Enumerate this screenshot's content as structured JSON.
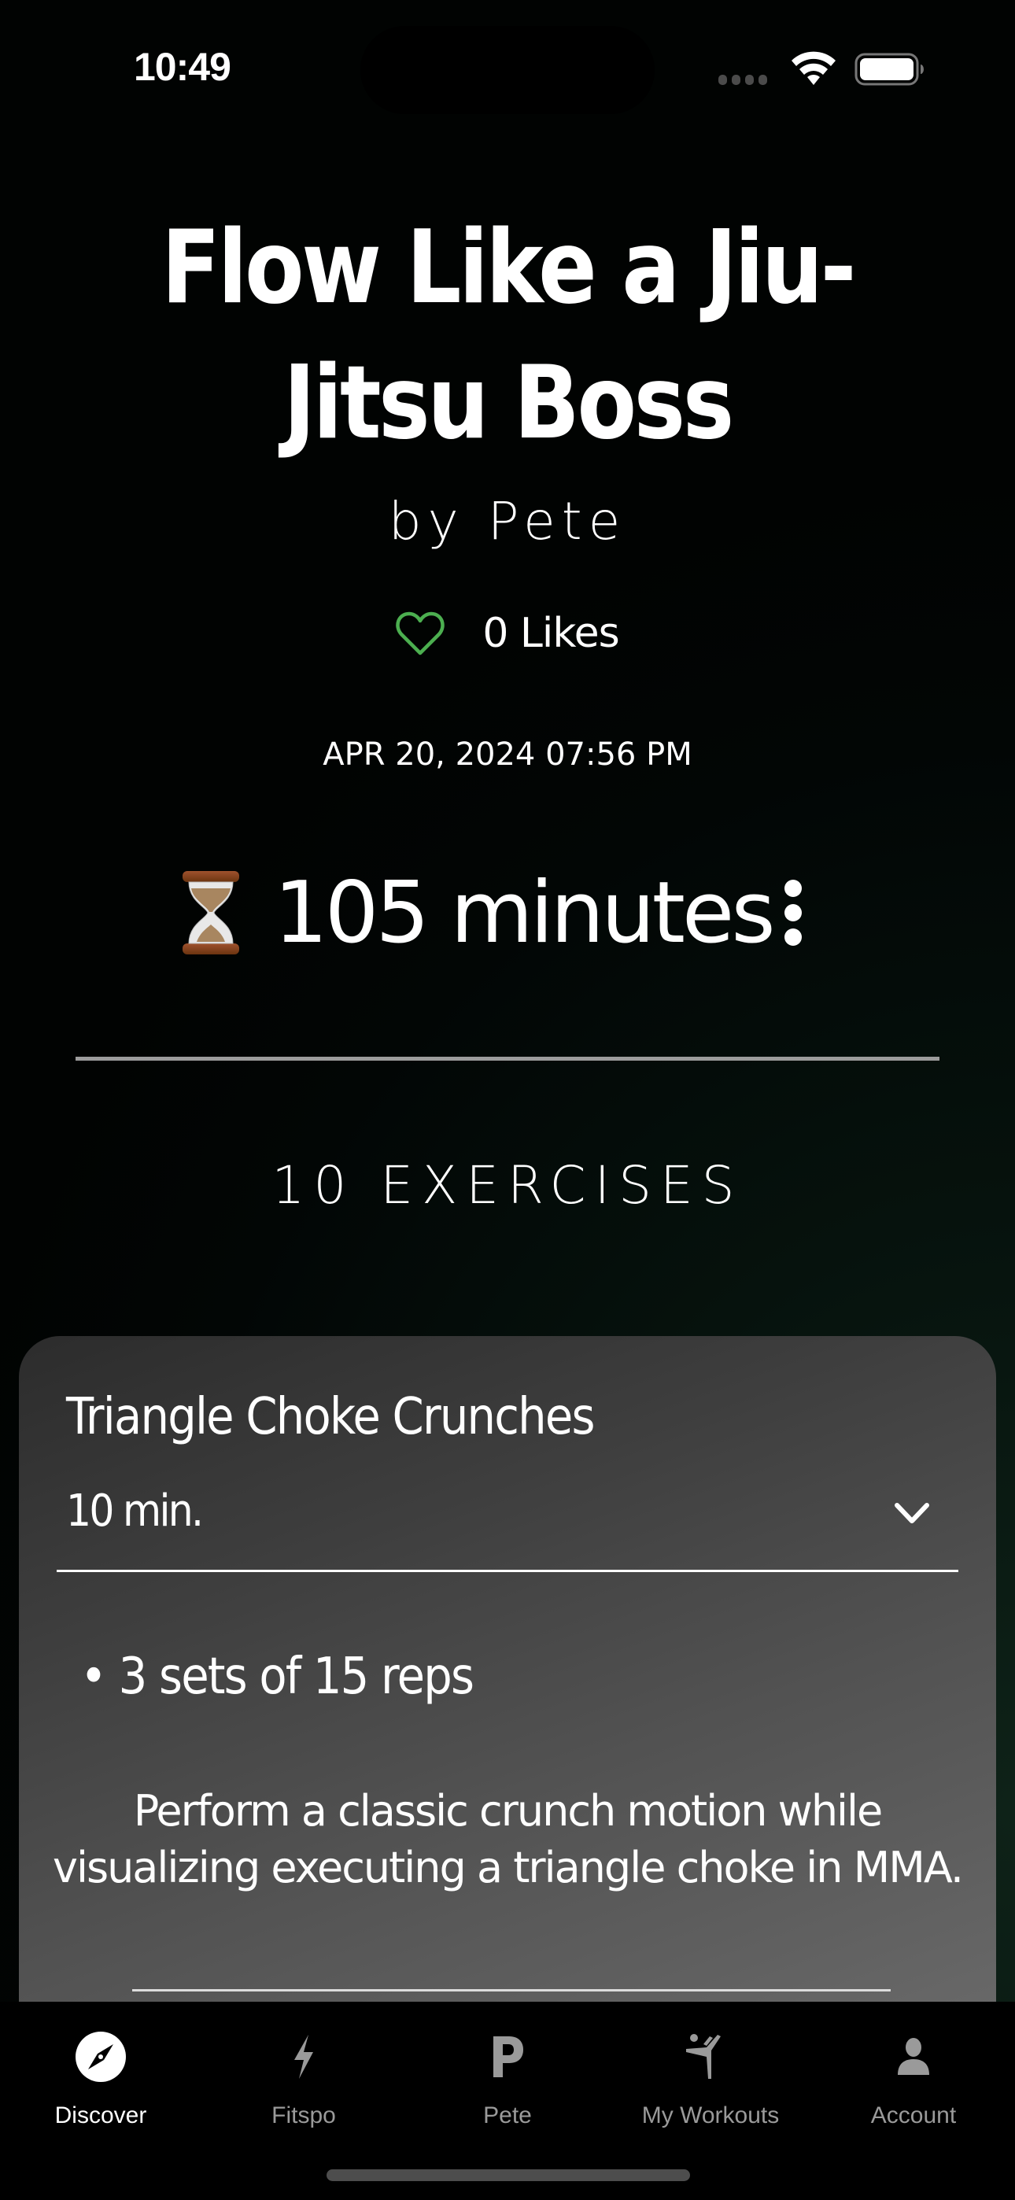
{
  "status_bar": {
    "time": "10:49",
    "icons": [
      "signal-icon",
      "wifi-icon",
      "battery-icon"
    ]
  },
  "workout": {
    "title": "Flow Like a Jiu-Jitsu Boss",
    "author": "by Pete",
    "likes_label": "0 Likes",
    "likes_count": 0,
    "date": "APR 20, 2024 07:56 PM",
    "duration_icon": "hourglass-icon",
    "duration": "105 minutes",
    "exercise_count_label": "10 EXERCISES"
  },
  "exercises": [
    {
      "name": "Triangle Choke Crunches",
      "time": "10 min.",
      "sets": "• 3 sets of 15 reps",
      "description": "Perform a classic crunch motion while visualizing executing a triangle choke in MMA."
    }
  ],
  "tabbar": {
    "items": [
      {
        "label": "Discover",
        "icon": "compass-icon",
        "active": true
      },
      {
        "label": "Fitspo",
        "icon": "lightning-icon",
        "active": false
      },
      {
        "label": "Pete",
        "icon": "letter-p-icon",
        "active": false
      },
      {
        "label": "My Workouts",
        "icon": "martial-arts-icon",
        "active": false
      },
      {
        "label": "Account",
        "icon": "person-icon",
        "active": false
      }
    ]
  },
  "colors": {
    "accent_green": "#4caf50",
    "tab_active": "#ffffff",
    "tab_inactive": "#9a9a9a"
  }
}
